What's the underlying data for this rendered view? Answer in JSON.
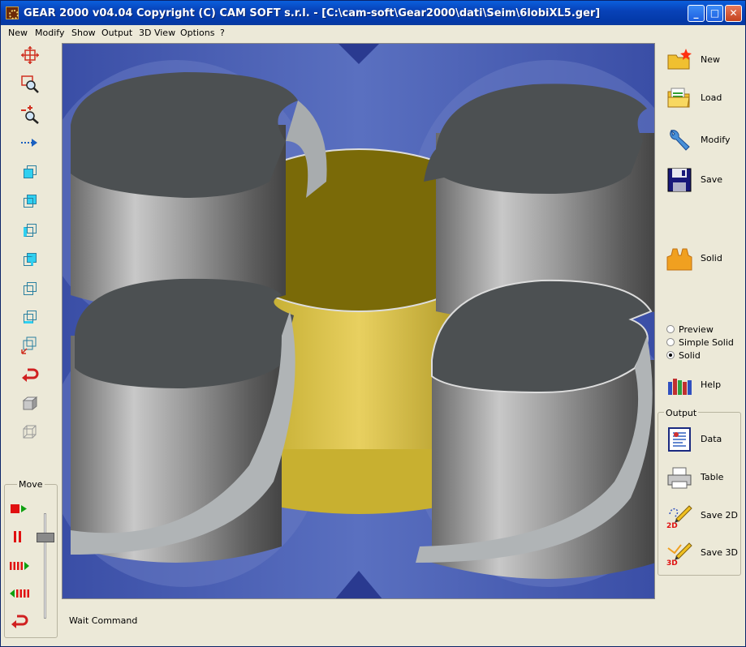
{
  "window": {
    "title": "GEAR 2000 v04.04      Copyright (C)  CAM SOFT s.r.l. - [C:\\cam-soft\\Gear2000\\dati\\Seim\\6lobiXL5.ger]",
    "min_symbol": "_",
    "max_symbol": "□",
    "close_symbol": "✕"
  },
  "menu": {
    "new": "New",
    "modify": "Modify",
    "show": "Show",
    "output": "Output",
    "view3d": "3D View",
    "options": "Options",
    "help": "?"
  },
  "move": {
    "label": "Move"
  },
  "status": {
    "text": "Wait Command"
  },
  "right_panel": {
    "new": "New",
    "load": "Load",
    "modify": "Modify",
    "save": "Save",
    "solid": "Solid",
    "help": "Help"
  },
  "render_mode": {
    "preview": "Preview",
    "simple_solid": "Simple Solid",
    "solid": "Solid",
    "selected": "Solid"
  },
  "output_group": {
    "label": "Output",
    "data": "Data",
    "table": "Table",
    "save2d": "Save 2D",
    "save3d": "Save 3D",
    "badge_2d": "2D",
    "badge_3d": "3D"
  }
}
